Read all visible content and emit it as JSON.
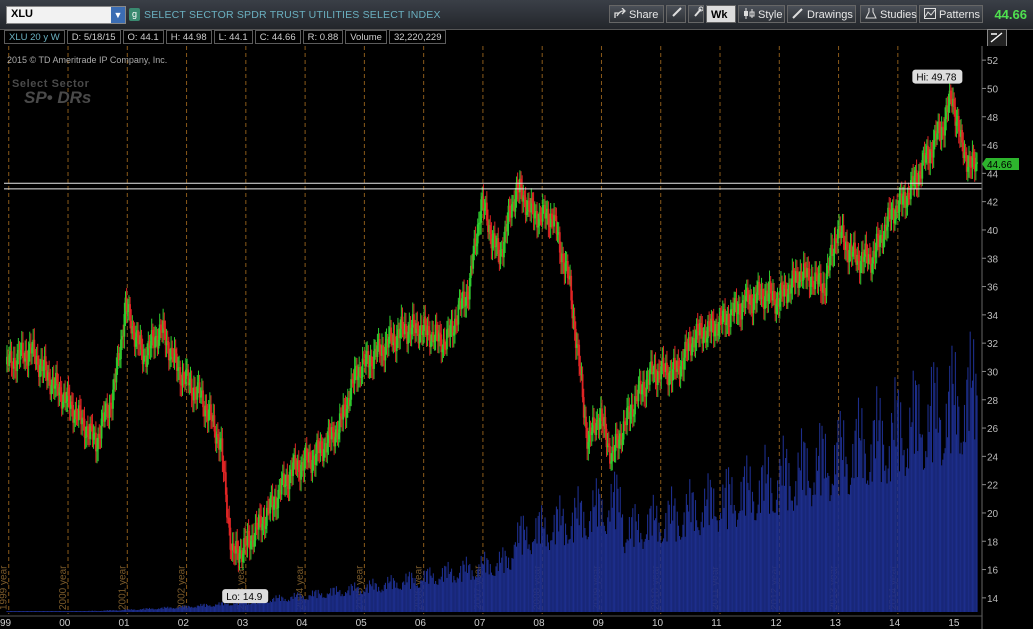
{
  "toolbar": {
    "symbol": "XLU",
    "badge": "g",
    "description": "SELECT SECTOR SPDR TRUST UTILITIES SELECT INDEX",
    "share": "Share",
    "period": "Wk",
    "style": "Style",
    "drawings": "Drawings",
    "studies": "Studies",
    "patterns": "Patterns",
    "last_price": "44.66"
  },
  "info": {
    "chart_setting": "XLU 20 y W",
    "date": "D: 5/18/15",
    "open": "O: 44.1",
    "high": "H: 44.98",
    "low": "L: 44.1",
    "close": "C: 44.66",
    "range": "R: 0.88",
    "volume_label": "Volume",
    "volume_value": "32,220,229"
  },
  "copyright": "2015 © TD Ameritrade IP Company, Inc.",
  "logo": {
    "line1": "Select Sector",
    "line2": "SP• DRs"
  },
  "colors": {
    "up": "#2ecc2e",
    "down": "#e02525",
    "volume": "#1d2e8c",
    "grid": "#8a5a1a",
    "price_tag": "#2db52d"
  },
  "chart_data": {
    "type": "candlestick",
    "interval": "weekly",
    "ylim": [
      13,
      53
    ],
    "y_ticks": [
      "14",
      "16",
      "18",
      "20",
      "22",
      "24",
      "26",
      "28",
      "30",
      "32",
      "34",
      "36",
      "38",
      "40",
      "42",
      "44",
      "46",
      "48",
      "50",
      "52"
    ],
    "x_ticks": [
      "99",
      "00",
      "01",
      "02",
      "03",
      "04",
      "05",
      "06",
      "07",
      "08",
      "09",
      "10",
      "11",
      "12",
      "13",
      "14",
      "15"
    ],
    "year_separators": [
      "1999 year",
      "2000 year",
      "2001 year",
      "2002 year",
      "2003 year",
      "2004 year",
      "2005 year",
      "2006 year",
      "2007 year",
      "2008 year",
      "2009 year",
      "2010 year",
      "2011 year",
      "2012 year",
      "2013 year",
      "2014 year"
    ],
    "series": [
      {
        "name": "",
        "x": [
          1999.0,
          1999.4,
          1999.8,
          2000.0,
          2000.5,
          2000.8,
          2001.0,
          2001.3,
          2001.6,
          2001.9,
          2002.3,
          2002.6,
          2002.8,
          2003.0,
          2003.4,
          2003.8,
          2004.2,
          2004.6,
          2004.9,
          2005.3,
          2005.7,
          2006.0,
          2006.4,
          2006.8,
          2007.0,
          2007.3,
          2007.6,
          2007.9,
          2008.2,
          2008.5,
          2008.8,
          2009.0,
          2009.2,
          2009.6,
          2009.9,
          2010.3,
          2010.6,
          2010.9,
          2011.2,
          2011.5,
          2011.8,
          2012.0,
          2012.4,
          2012.8,
          2013.0,
          2013.3,
          2013.6,
          2013.9,
          2014.2,
          2014.5,
          2014.8,
          2014.95,
          2015.1,
          2015.25,
          2015.38
        ],
        "y": [
          30.5,
          31.5,
          29,
          28,
          25,
          28.5,
          34.5,
          31,
          33,
          30,
          28,
          25,
          17,
          17.5,
          20,
          23,
          24,
          26,
          30,
          31.5,
          33,
          33,
          32,
          36,
          42,
          38,
          43,
          41,
          41,
          36,
          25,
          27,
          24,
          28,
          30,
          30,
          32.5,
          33,
          34,
          35,
          35.5,
          35,
          37,
          36,
          40,
          38,
          38,
          41,
          42.5,
          45,
          47.5,
          49.5,
          46,
          44.5,
          44.66
        ]
      }
    ],
    "volume_scale": "relative",
    "annotations": {
      "high": "Hi: 49.78",
      "low": "Lo: 14.9"
    },
    "reference_lines": [
      43.3,
      42.9
    ],
    "price_tag": "44.66"
  }
}
